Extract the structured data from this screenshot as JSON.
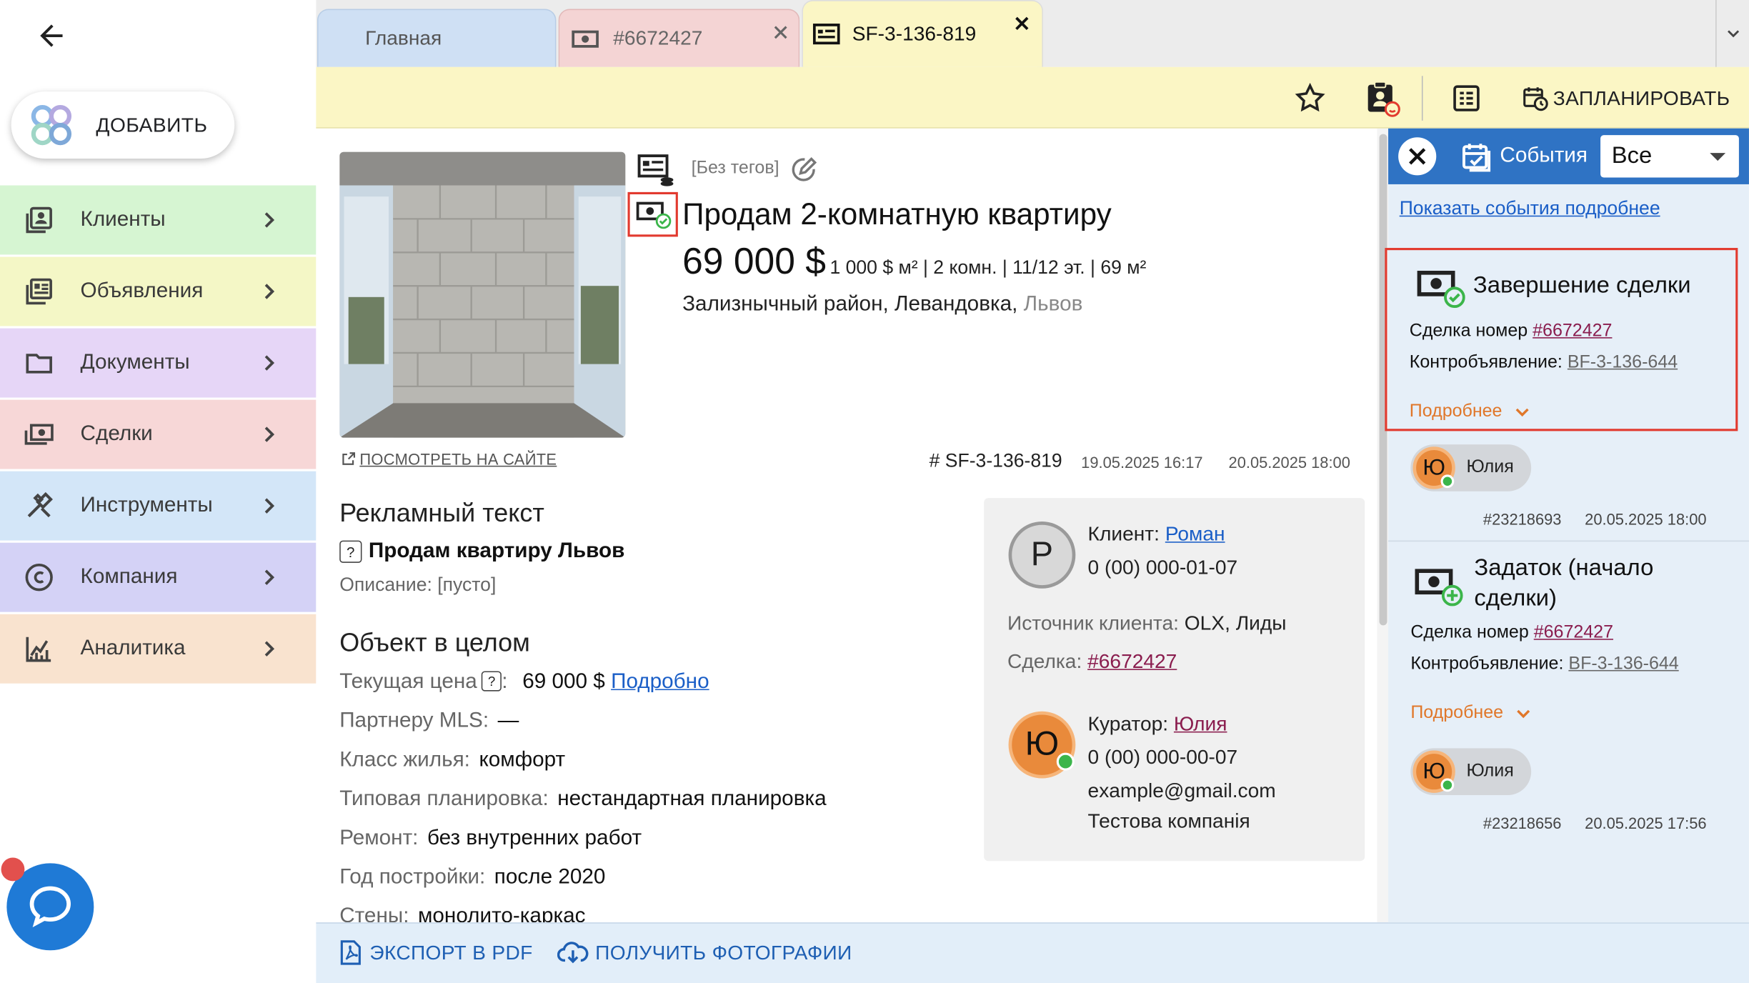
{
  "sidebar": {
    "add_label": "ДОБАВИТЬ",
    "items": [
      {
        "label": "Клиенты",
        "color": "#d6f5d2"
      },
      {
        "label": "Объявления",
        "color": "#f4f7c6"
      },
      {
        "label": "Документы",
        "color": "#e6d6f7"
      },
      {
        "label": "Сделки",
        "color": "#f7d7d7"
      },
      {
        "label": "Инструменты",
        "color": "#d3e6f8"
      },
      {
        "label": "Компания",
        "color": "#d4d2f6"
      },
      {
        "label": "Аналитика",
        "color": "#f9e3cf"
      }
    ]
  },
  "tabs": {
    "home": "Главная",
    "deal": "#6672427",
    "active": "SF-3-136-819"
  },
  "toolbar": {
    "plan_label": "ЗАПЛАНИРОВАТЬ"
  },
  "listing": {
    "tags": "[Без тегов]",
    "title": "Продам 2-комнатную квартиру",
    "price": "69 000 $",
    "meta": "1 000 $ м² | 2 комн. | 11/12 эт. | 69 м²",
    "address": "Зализнычный район, Левандовка,",
    "city": "Львов",
    "view_site": "ПОСМОТРЕТЬ НА САЙТЕ",
    "id": "# SF-3-136-819",
    "date_created": "19.05.2025 16:17",
    "date_updated": "20.05.2025 18:00"
  },
  "ad": {
    "heading": "Рекламный текст",
    "qmark": "?",
    "text": "Продам квартиру Львов",
    "description": "Описание: [пусто]"
  },
  "object": {
    "heading": "Объект в целом",
    "price_label": "Текущая цена",
    "price_colon": ":",
    "price_value": "69 000 $",
    "price_link": "Подробно",
    "rows": [
      {
        "label": "Партнеру MLS:",
        "value": "—"
      },
      {
        "label": "Класс жилья:",
        "value": "комфорт"
      },
      {
        "label": "Типовая планировка:",
        "value": "нестандартная планировка"
      },
      {
        "label": "Ремонт:",
        "value": "без внутренних работ"
      },
      {
        "label": "Год постройки:",
        "value": "после 2020"
      },
      {
        "label": "Стены:",
        "value": "монолито-каркас"
      }
    ]
  },
  "client": {
    "avatar": "Р",
    "label": "Клиент:",
    "name": "Роман",
    "phone": "0 (00) 000-01-07",
    "source_label": "Источник клиента:",
    "source_value": "OLX, Лиды",
    "deal_label": "Сделка:",
    "deal_value": "#6672427"
  },
  "curator": {
    "avatar": "Ю",
    "label": "Куратор:",
    "name": "Юлия",
    "phone": "0 (00) 000-00-07",
    "email": "example@gmail.com",
    "company": "Тестова компанія"
  },
  "bottom": {
    "export_label": "ЭКСПОРТ В PDF",
    "photos_label": "ПОЛУЧИТЬ ФОТОГРАФИИ"
  },
  "events": {
    "title": "События",
    "filter": "Все",
    "show_more": "Показать события подробнее",
    "list": [
      {
        "name": "Завершение сделки",
        "deal_label": "Сделка номер",
        "deal": "#6672427",
        "counter_label": "Контробъявление:",
        "counter": "BF-3-136-644",
        "more": "Подробнее",
        "user_avatar": "Ю",
        "user": "Юлия",
        "id": "#23218693",
        "date": "20.05.2025 18:00"
      },
      {
        "name": "Задаток (начало сделки)",
        "deal_label": "Сделка номер",
        "deal": "#6672427",
        "counter_label": "Контробъявление:",
        "counter": "BF-3-136-644",
        "more": "Подробнее",
        "user_avatar": "Ю",
        "user": "Юлия",
        "id": "#23218656",
        "date": "20.05.2025 17:56"
      }
    ]
  },
  "colors": {
    "accent_blue": "#2f73c4",
    "highlight_red": "#e23a2f",
    "toolbar_yellow": "#fbf6c5",
    "link_orange": "#e0772a",
    "online_green": "#3bb54a"
  }
}
